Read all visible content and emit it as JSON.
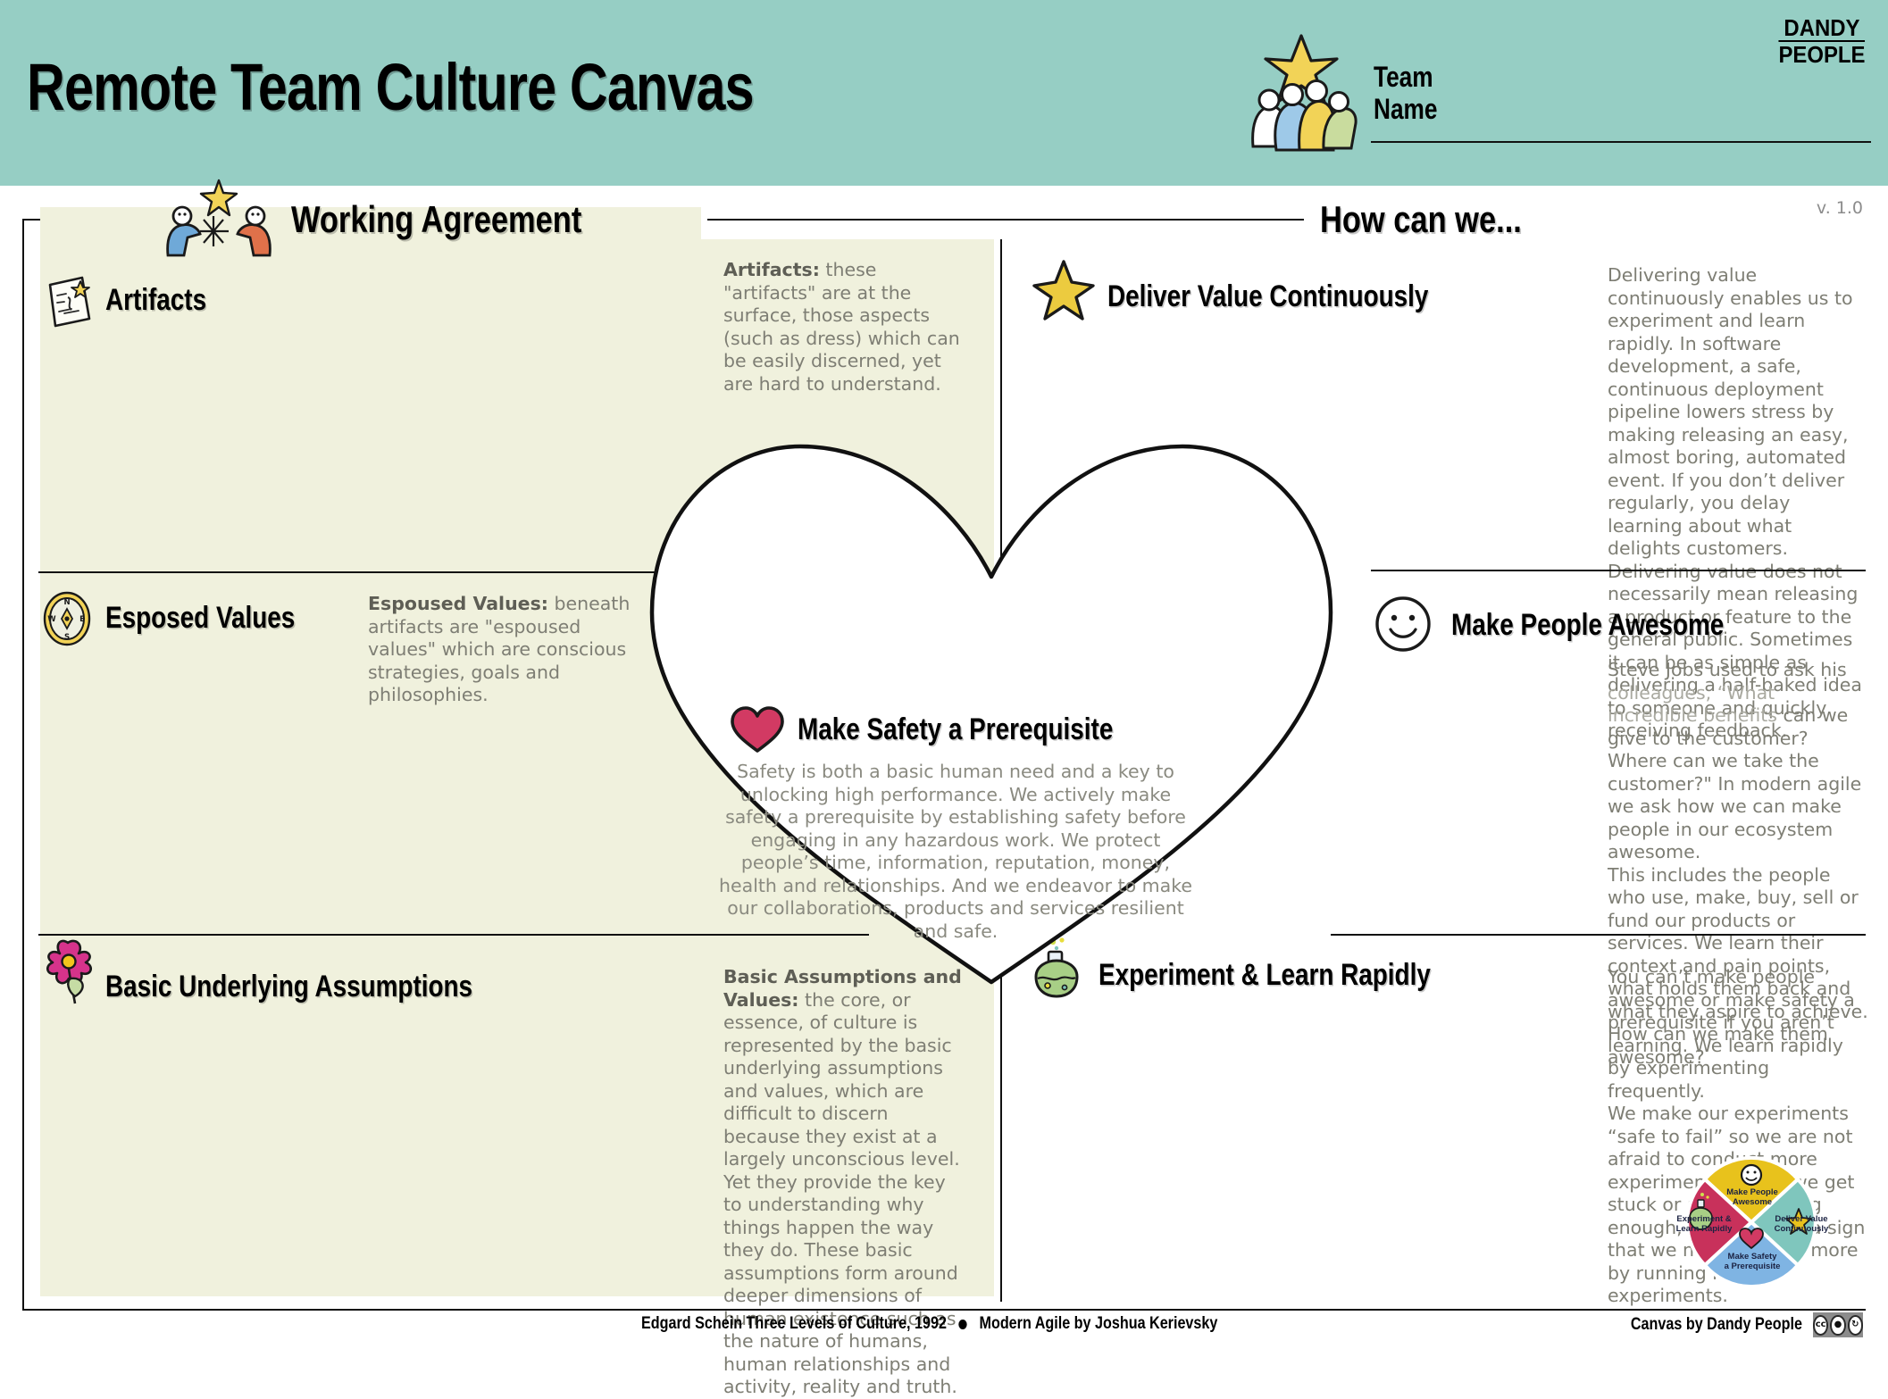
{
  "header": {
    "title": "Remote Team Culture Canvas",
    "team_label": "Team\nName",
    "team_icon": "team-star-icon",
    "logo_line1": "DANDY",
    "logo_line2": "PEOPLE",
    "background_color": "#96cec4"
  },
  "meta": {
    "version": "v. 1.0"
  },
  "left_panel": {
    "title": "Working Agreement",
    "title_icon": "two-people-highfive-icon",
    "background_color": "#f0f1dd",
    "sections": [
      {
        "heading": "Artifacts",
        "icon": "document-star-icon",
        "desc_lead": "Artifacts:",
        "desc_body": " these \"artifacts\" are at the surface, those aspects (such as dress) which can be easily discerned, yet are hard to understand."
      },
      {
        "heading": "Esposed Values",
        "icon": "compass-icon",
        "desc_lead": "Espoused Values:",
        "desc_body": " beneath artifacts are \"espoused values\" which are conscious strategies, goals and philosophies."
      },
      {
        "heading": "Basic Underlying Assumptions",
        "icon": "flower-icon",
        "desc_lead": "Basic Assumptions and Values:",
        "desc_body": " the core, or essence, of culture is represented by the basic underlying assumptions and values, which are difficult to discern because they exist at a largely unconscious level. Yet they provide the key to understanding why things happen the way they do. These basic assumptions form around deeper dimensions of human existence such as the nature of humans, human relationships and activity, reality and truth."
      }
    ]
  },
  "right_panel": {
    "title": "How can we...",
    "sections": [
      {
        "heading": "Deliver Value Continuously",
        "icon": "star-icon",
        "desc": "Delivering value continuously enables us to experiment and learn rapidly. In software development, a safe, continuous deployment pipeline lowers stress by making releasing an easy, almost boring, automated event. If you don’t deliver regularly, you delay learning about what delights customers. Delivering value does not necessarily mean releasing a product or feature to the general public. Sometimes it can be as simple as delivering a half-baked idea to someone and quickly receiving feedback."
      },
      {
        "heading": "Make People Awesome",
        "icon": "smiley-icon",
        "desc_part1": "Steve Jobs used to ask his ",
        "desc_faded": "colleagues, “What incredible benefits",
        "desc_part2": " can we give to the customer? Where can we take the customer?\" In modern agile we ask how we can make people in our ecosystem awesome.",
        "desc_part3": "This includes the people who use, make, buy, sell or fund our products or services. We learn their context and pain points, what holds them back and what they aspire to achieve. How can we make them awesome?"
      },
      {
        "heading": "Experiment & Learn Rapidly",
        "icon": "beaker-icon",
        "desc_part1": "You can’t make people awesome or make safety a prerequisite if you aren’t learning. We learn rapidly by experimenting frequently.",
        "desc_part2": "We make our experiments “safe to fail” so we are not afraid to conduct more experiments. When we get stuck or aren’t learning enough, we take it as a sign that we need to learn more by running more experiments."
      }
    ]
  },
  "center": {
    "heading": "Make Safety a Prerequisite",
    "icon": "heart-icon",
    "desc": "Safety is both a basic human need and a key to unlocking high performance. We actively make safety a prerequisite by establishing safety before engaging in any hazardous work. We protect people’s time, information, reputation, money, health and relationships. And we endeavor to make our collaborations, products and services resilient and safe."
  },
  "wheel": {
    "name": "modern-agile-wheel",
    "quadrants": [
      {
        "label": "Make People\nAwesome",
        "color": "#e8c21c",
        "icon": "smiley-icon"
      },
      {
        "label": "Deliver Value\nContinuously",
        "color": "#7fc6bd",
        "icon": "star-icon"
      },
      {
        "label": "Make Safety\na Prerequisite",
        "color": "#7fb4e3",
        "icon": "heart-icon"
      },
      {
        "label": "Experiment &\nLearn Rapidly",
        "color": "#c8315b",
        "icon": "beaker-icon"
      }
    ]
  },
  "footer": {
    "credit_1": "Edgard Schein Three Levels of Culture, 1992",
    "credit_2": "Modern Agile by Joshua Kerievsky",
    "credit_right": "Canvas by Dandy People",
    "license_badge": "CC BY SA"
  },
  "colors": {
    "header_teal": "#96cec4",
    "panel_cream": "#f0f1dd",
    "body_gray": "#7e7e74",
    "star_yellow": "#eccb3f",
    "heart_pink": "#d23a63"
  }
}
